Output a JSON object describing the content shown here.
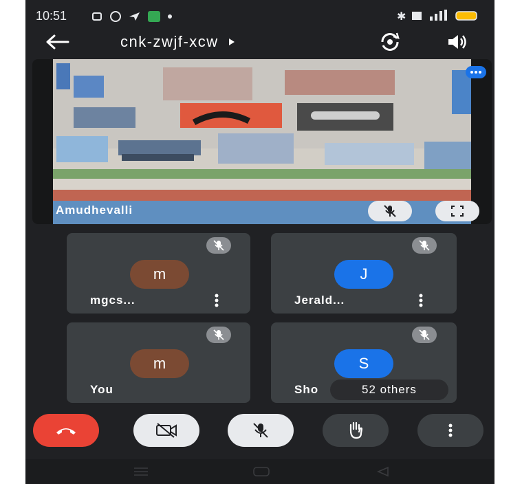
{
  "status_bar": {
    "time": "10:51"
  },
  "header": {
    "meeting_code": "cnk-zwjf-xcw",
    "icons": [
      "back-arrow-icon",
      "switch-camera-icon",
      "speaker-icon"
    ]
  },
  "featured": {
    "name": "Amudhevalli"
  },
  "participants": [
    {
      "name": "mgcs...",
      "initial": "m",
      "color": "#7b4a33"
    },
    {
      "name": "Jerald...",
      "initial": "J",
      "color": "#1a73e8"
    },
    {
      "name": "You",
      "initial": "m",
      "color": "#7b4a33"
    },
    {
      "name": "Sho",
      "initial": "S",
      "color": "#1a73e8"
    }
  ],
  "others_label": "52 others",
  "colors": {
    "background": "#202124",
    "tile": "#3c4043",
    "end_call": "#ea4335"
  }
}
